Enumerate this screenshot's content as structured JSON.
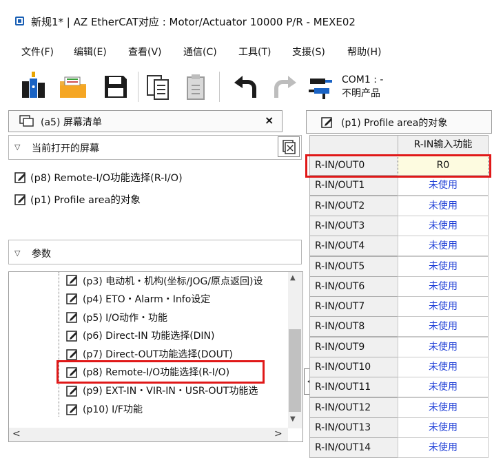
{
  "window": {
    "title": "新规1* | AZ EtherCAT对应 : Motor/Actuator 10000 P/R - MEXE02"
  },
  "menu": [
    "文件(F)",
    "编辑(E)",
    "查看(V)",
    "通信(C)",
    "工具(T)",
    "支援(S)",
    "帮助(H)"
  ],
  "toolbar": {
    "com_port": "COM1 : -",
    "product": "不明产品"
  },
  "left_panel": {
    "header": "(a5) 屏幕清单",
    "close": "×",
    "open_section": "当前打开的屏幕",
    "open_screens": [
      "(p8) Remote-I/O功能选择(R-I/O)",
      "(p1) Profile area的对象"
    ],
    "param_section": "参数",
    "params": [
      "(p3) 电动机・机构(坐标/JOG/原点返回)设",
      "(p4) ETO・Alarm・Info设定",
      "(p5) I/O动作・功能",
      "(p6) Direct-IN 功能选择(DIN)",
      "(p7) Direct-OUT功能选择(DOUT)",
      "(p8) Remote-I/O功能选择(R-I/O)",
      "(p9) EXT-IN・VIR-IN・USR-OUT功能选",
      "(p10) I/F功能"
    ]
  },
  "splitter": {
    "glyph": "◁||"
  },
  "right_panel": {
    "header": "(p1) Profile area的对象",
    "column": "R-IN输入功能",
    "rows": [
      {
        "name": "R-IN/OUT0",
        "value": "R0"
      },
      {
        "name": "R-IN/OUT1",
        "value": "未使用"
      },
      {
        "name": "R-IN/OUT2",
        "value": "未使用"
      },
      {
        "name": "R-IN/OUT3",
        "value": "未使用"
      },
      {
        "name": "R-IN/OUT4",
        "value": "未使用"
      },
      {
        "name": "R-IN/OUT5",
        "value": "未使用"
      },
      {
        "name": "R-IN/OUT6",
        "value": "未使用"
      },
      {
        "name": "R-IN/OUT7",
        "value": "未使用"
      },
      {
        "name": "R-IN/OUT8",
        "value": "未使用"
      },
      {
        "name": "R-IN/OUT9",
        "value": "未使用"
      },
      {
        "name": "R-IN/OUT10",
        "value": "未使用"
      },
      {
        "name": "R-IN/OUT11",
        "value": "未使用"
      },
      {
        "name": "R-IN/OUT12",
        "value": "未使用"
      },
      {
        "name": "R-IN/OUT13",
        "value": "未使用"
      },
      {
        "name": "R-IN/OUT14",
        "value": "未使用"
      }
    ]
  },
  "colors": {
    "highlight": "#e01818",
    "value_blue": "#1f3fd6",
    "selected_cell": "#fdfbe0"
  }
}
